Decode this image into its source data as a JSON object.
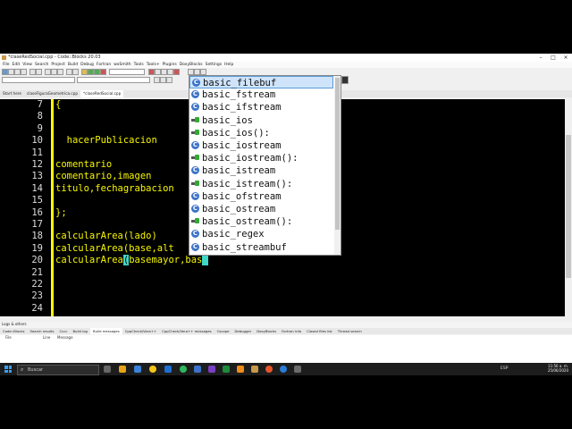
{
  "window": {
    "title": "*claseRedSocial.cpp - Code::Blocks 20.03"
  },
  "menu": [
    "File",
    "Edit",
    "View",
    "Search",
    "Project",
    "Build",
    "Debug",
    "Fortran",
    "wxSmith",
    "Tools",
    "Tools+",
    "Plugins",
    "DoxyBlocks",
    "Settings",
    "Help"
  ],
  "tabs": [
    {
      "label": "Start here",
      "active": false
    },
    {
      "label": "claseFiguraGeometrica.cpp",
      "active": false
    },
    {
      "label": "*claseRedSocial.cpp",
      "active": true
    }
  ],
  "editor": {
    "line_numbers": [
      "7",
      "8",
      "9",
      "10",
      "11",
      "12",
      "13",
      "14",
      "15",
      "16",
      "17",
      "18",
      "19",
      "20",
      "21",
      "22",
      "23",
      "24"
    ],
    "lines": [
      "{",
      "",
      "",
      "  hacerPublicacion",
      "",
      "comentario",
      "comentario,imagen",
      "titulo,fechagrabacion",
      "",
      "};",
      "",
      "calcularArea(lado)",
      "calcularArea(base,alt",
      "calcularArea",
      "",
      "",
      "",
      ""
    ],
    "cursor_line": {
      "before": "calcularArea",
      "cursor": "(",
      "after": "basemayor,bas"
    }
  },
  "autocomplete": {
    "items": [
      {
        "label": "basic_filebuf",
        "icon": "class-icon",
        "selected": true
      },
      {
        "label": "basic_fstream",
        "icon": "class-icon",
        "selected": false
      },
      {
        "label": "basic_ifstream",
        "icon": "class-icon",
        "selected": false
      },
      {
        "label": "basic_ios",
        "icon": "function-icon",
        "selected": false
      },
      {
        "label": "basic_ios():",
        "icon": "function-icon",
        "selected": false
      },
      {
        "label": "basic_iostream",
        "icon": "class-icon",
        "selected": false
      },
      {
        "label": "basic_iostream():",
        "icon": "function-icon",
        "selected": false
      },
      {
        "label": "basic_istream",
        "icon": "class-icon",
        "selected": false
      },
      {
        "label": "basic_istream():",
        "icon": "function-icon",
        "selected": false
      },
      {
        "label": "basic_ofstream",
        "icon": "class-icon",
        "selected": false
      },
      {
        "label": "basic_ostream",
        "icon": "class-icon",
        "selected": false
      },
      {
        "label": "basic_ostream():",
        "icon": "function-icon",
        "selected": false
      },
      {
        "label": "basic_regex",
        "icon": "class-icon",
        "selected": false
      },
      {
        "label": "basic_streambuf",
        "icon": "class-icon",
        "selected": false
      }
    ]
  },
  "logs": {
    "title": "Logs & others",
    "tabs": [
      "Code::Blocks",
      "Search results",
      "Cccc",
      "Build log",
      "Build messages",
      "CppCheck/Vera++",
      "CppCheck/Vera++ messages",
      "Cscope",
      "Debugger",
      "DoxyBlocks",
      "Fortran info",
      "Closed files list",
      "Thread search"
    ],
    "active_tab": "Build messages",
    "columns": [
      "File",
      "Line",
      "Message"
    ]
  },
  "taskbar": {
    "search_placeholder": "Buscar",
    "lang": "ESP",
    "time": "11:56 a. m.",
    "date": "25/06/2020"
  }
}
